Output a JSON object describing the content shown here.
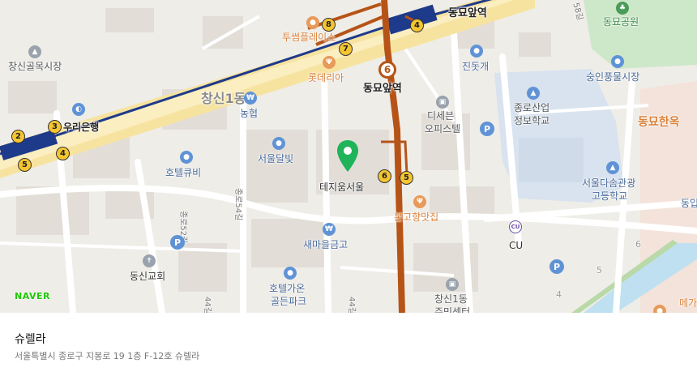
{
  "map": {
    "attribution": "NAVER",
    "places": {
      "dongmyo_park": "동묘공원",
      "dongmyo_station_top": "동묘앞역",
      "dongmyo_station": "동묘앞역",
      "changsin_market": "창신골목시장",
      "twosome": "투썸플레이스",
      "lotteria": "롯데리아",
      "jinstgae": "진돗개",
      "sunginpoong": "숭인풍물시장",
      "changsin1": "창신1동",
      "nonghyup": "농협",
      "woori": "우리은행",
      "dicebon": "디세븐",
      "office": "오피스텔",
      "jongno_school": "종로산업",
      "jongno_school2": "정보학교",
      "dongmyo_market": "동묘한옥",
      "seoul_dalbit": "서울달빛",
      "hotel_qbe": "호텔큐비",
      "tzium": "테지움서울",
      "seoul_dasom": "서울다솜관광",
      "seoul_dasom2": "고등학교",
      "bongo": "본고향맛집",
      "cu": "CU",
      "saemaeul": "새마을금고",
      "dongsin_church": "동신교회",
      "hotel_golden": "호텔가온",
      "hotel_golden2": "골든파크",
      "changsin1_center": "창신1동",
      "changsin1_center2": "주민센터",
      "dongip": "동입",
      "megacoffee": "메가",
      "street_52": "종로52길",
      "street_54": "종로54길",
      "street_44a": "44길",
      "street_44b": "44길",
      "street_58": "58길"
    },
    "subway_exits": [
      "1",
      "2",
      "3",
      "4",
      "5",
      "4",
      "5",
      "6",
      "5",
      "7",
      "8"
    ],
    "line6_number": "6",
    "block_numbers": [
      "4",
      "5",
      "6"
    ],
    "colors": {
      "line1": "#1e3a8a",
      "line6": "#b65418",
      "main_road": "#f7e3a0",
      "park": "#cde8c8",
      "pin": "#1fb35a"
    }
  },
  "place": {
    "name": "슈렐라",
    "address": "서울특별시 종로구 지봉로 19 1층 F-12호 슈렐라"
  }
}
